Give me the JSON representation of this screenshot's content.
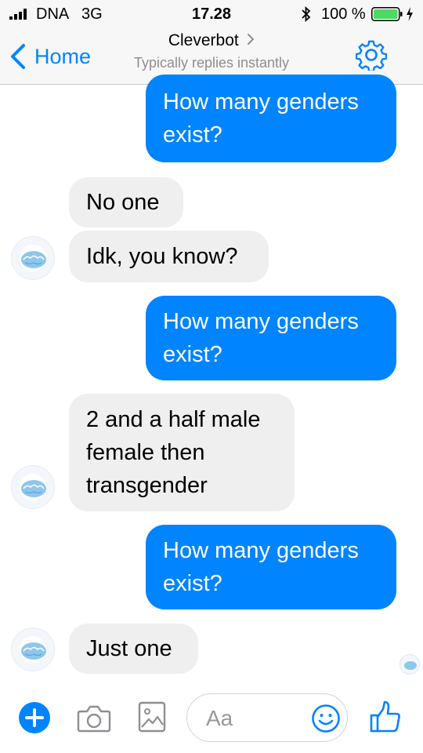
{
  "status_bar": {
    "carrier": "DNA",
    "network": "3G",
    "time": "17.28",
    "battery_percent": "100 %",
    "icons": [
      "signal-bars-icon",
      "bluetooth-icon",
      "battery-icon",
      "charging-icon"
    ]
  },
  "nav": {
    "back_label": "Home",
    "title": "Cleverbot",
    "subtitle": "Typically replies instantly",
    "icons": [
      "chevron-left-icon",
      "chevron-right-icon",
      "gear-icon"
    ]
  },
  "messages": [
    {
      "from": "me",
      "text": "How many genders\nexist?"
    },
    {
      "from": "bot",
      "text": "No one"
    },
    {
      "from": "bot",
      "text": "Idk, you know?"
    },
    {
      "from": "me",
      "text": "How many genders\nexist?"
    },
    {
      "from": "bot",
      "text": "2 and a half male\nfemale then\ntransgender"
    },
    {
      "from": "me",
      "text": "How many genders\nexist?"
    },
    {
      "from": "bot",
      "text": "Just one"
    }
  ],
  "composer": {
    "placeholder": "Aa",
    "icons": [
      "plus-icon",
      "camera-icon",
      "gallery-icon",
      "emoji-icon",
      "thumbs-up-icon"
    ]
  },
  "colors": {
    "accent": "#0084ff",
    "incoming_bubble": "#efeff0",
    "header_bg": "#f7f7f8",
    "subtitle": "#8e8e93"
  }
}
